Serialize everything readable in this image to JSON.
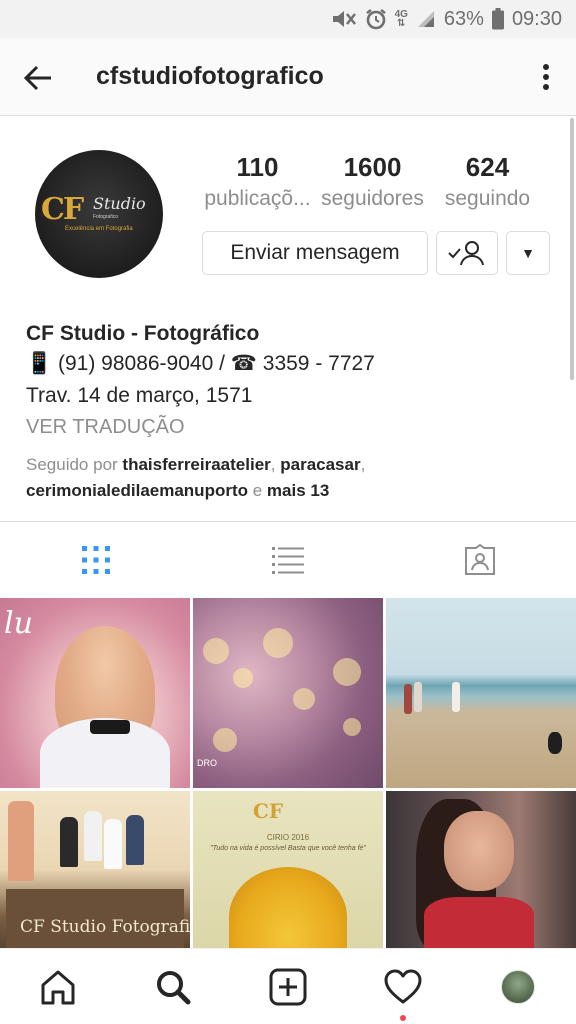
{
  "status_bar": {
    "network": "4G",
    "battery": "63%",
    "time": "09:30"
  },
  "header": {
    "title": "cfstudiofotografico"
  },
  "profile": {
    "avatar_text": {
      "mark": "CF",
      "script": "Studio",
      "sub": "Fotografico",
      "tagline": "Excelência em Fotografia"
    },
    "stats": [
      {
        "value": "110",
        "label": "publicaçõ..."
      },
      {
        "value": "1600",
        "label": "seguidores"
      },
      {
        "value": "624",
        "label": "seguindo"
      }
    ],
    "message_button": "Enviar mensagem",
    "dropdown_glyph": "▼"
  },
  "bio": {
    "name": "CF Studio - Fotográfico",
    "phone_line": "📱 (91) 98086-9040 / ☎ 3359 - 7727",
    "address": "Trav. 14 de março, 1571",
    "translate": "VER TRADUÇÃO",
    "followed_prefix": "Seguido por ",
    "followed_user1": "thaisferreiraatelier",
    "followed_sep1": ", ",
    "followed_user2": "paracasar",
    "followed_sep2": ",",
    "followed_user3": "cerimonialedilaemanuporto",
    "followed_and": " e ",
    "followed_more": "mais 13"
  },
  "grid": {
    "post1_script": "lu",
    "post2_caption": "DRO",
    "post4_sign": "CF Studio Fotografico",
    "post5_logo": "CF",
    "post5_title": "CIRIO 2016",
    "post5_quote": "\"Tudo na vida é possível Basta que você tenha fé\""
  },
  "colors": {
    "accent_blue": "#3897f0",
    "icon_gray": "#8e8e8e",
    "notification_red": "#ed4956"
  },
  "icons": {
    "back": "arrow-left-icon",
    "more": "kebab-menu-icon",
    "grid_tab": "grid-icon",
    "list_tab": "list-icon",
    "tagged_tab": "tagged-person-icon",
    "home": "home-icon",
    "search": "search-icon",
    "add": "add-post-icon",
    "activity": "heart-icon",
    "profile": "profile-avatar-icon"
  }
}
